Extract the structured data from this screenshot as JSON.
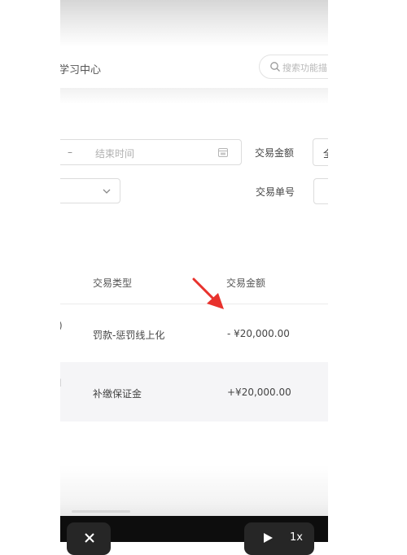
{
  "header": {
    "title": "学习中心",
    "search_placeholder": "搜索功能描"
  },
  "filters": {
    "date_separator": "–",
    "end_time_placeholder": "结束时间",
    "amount_label": "交易金额",
    "amount_value": "全",
    "order_label": "交易单号"
  },
  "table": {
    "headers": {
      "type": "交易类型",
      "amount": "交易金额"
    },
    "rows": [
      {
        "cut_text": ")",
        "type": "罚款-惩罚线上化",
        "amount": "- ¥20,000.00"
      },
      {
        "cut_text": "l",
        "type": "补缴保证金",
        "amount": "+¥20,000.00"
      }
    ]
  },
  "player": {
    "speed": "1x"
  },
  "colors": {
    "annotation_arrow": "#e8322d",
    "player_bar": "#0d0d0d"
  }
}
